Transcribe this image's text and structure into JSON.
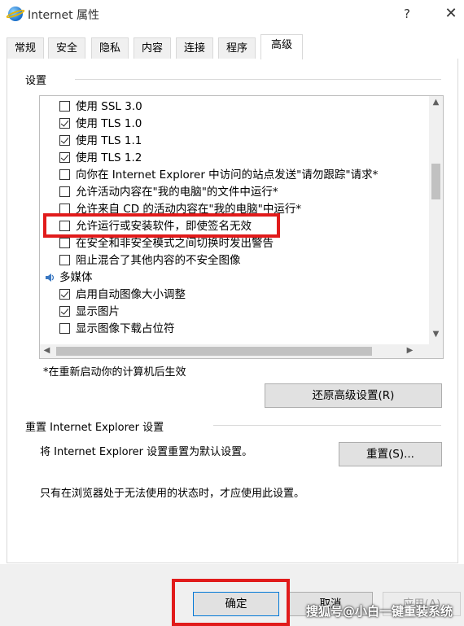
{
  "window": {
    "title": "Internet 属性",
    "help": "?",
    "close": "✕"
  },
  "tabs": [
    "常规",
    "安全",
    "隐私",
    "内容",
    "连接",
    "程序",
    "高级"
  ],
  "settings": {
    "group_label": "设置",
    "items": [
      {
        "type": "check",
        "checked": false,
        "label": "使用 SSL 3.0"
      },
      {
        "type": "check",
        "checked": true,
        "label": "使用 TLS 1.0"
      },
      {
        "type": "check",
        "checked": true,
        "label": "使用 TLS 1.1"
      },
      {
        "type": "check",
        "checked": true,
        "label": "使用 TLS 1.2"
      },
      {
        "type": "check",
        "checked": false,
        "label": "向你在 Internet Explorer 中访问的站点发送\"请勿跟踪\"请求*"
      },
      {
        "type": "check",
        "checked": false,
        "label": "允许活动内容在\"我的电脑\"的文件中运行*"
      },
      {
        "type": "check",
        "checked": false,
        "label": "允许来自 CD 的活动内容在\"我的电脑\"中运行*"
      },
      {
        "type": "check",
        "checked": false,
        "label": "允许运行或安装软件，即使签名无效"
      },
      {
        "type": "check",
        "checked": false,
        "label": "在安全和非安全模式之间切换时发出警告"
      },
      {
        "type": "check",
        "checked": false,
        "label": "阻止混合了其他内容的不安全图像"
      },
      {
        "type": "category",
        "label": "多媒体"
      },
      {
        "type": "check",
        "checked": true,
        "label": "启用自动图像大小调整"
      },
      {
        "type": "check",
        "checked": true,
        "label": "显示图片"
      },
      {
        "type": "check",
        "checked": false,
        "label": "显示图像下载占位符"
      }
    ],
    "note": "*在重新启动你的计算机后生效",
    "restore_button": "还原高级设置(R)"
  },
  "reset": {
    "group_label": "重置 Internet Explorer 设置",
    "description": "将 Internet Explorer 设置重置为默认设置。",
    "button": "重置(S)...",
    "warning": "只有在浏览器处于无法使用的状态时，才应使用此设置。"
  },
  "footer": {
    "ok": "确定",
    "cancel": "取消",
    "apply": "应用(A)"
  },
  "watermark": "搜狐号@小白一键重装系统",
  "colors": {
    "highlight": "#e11b1b",
    "accent": "#0078d7"
  }
}
